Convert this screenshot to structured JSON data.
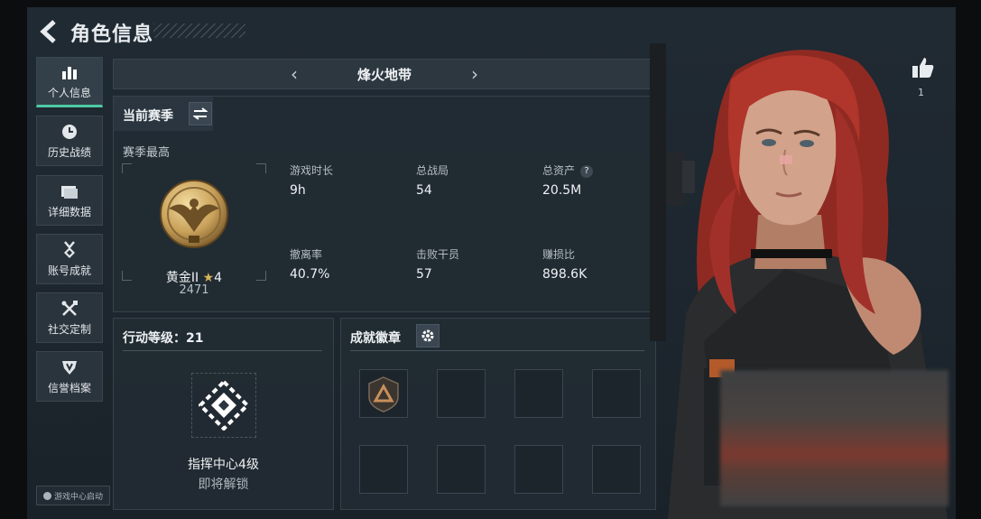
{
  "header": {
    "title": "角色信息"
  },
  "sidebar": {
    "items": [
      {
        "label": "个人信息",
        "icon": "bar-chart-icon",
        "active": true
      },
      {
        "label": "历史战绩",
        "icon": "clock-icon",
        "active": false
      },
      {
        "label": "详细数据",
        "icon": "folder-icon",
        "active": false
      },
      {
        "label": "账号成就",
        "icon": "medal-icon",
        "active": false
      },
      {
        "label": "社交定制",
        "icon": "tools-icon",
        "active": false
      },
      {
        "label": "信誉档案",
        "icon": "shield-icon",
        "active": false
      }
    ],
    "help_label": "游戏中心启动"
  },
  "map_selector": {
    "name": "烽火地带",
    "prev": "‹",
    "next": "›"
  },
  "season": {
    "title": "当前赛季",
    "subtitle": "赛季最高",
    "rank_name": "黄金II",
    "rank_stars": "4",
    "rank_score": "2471",
    "stats": [
      {
        "label": "游戏时长",
        "value": "9h"
      },
      {
        "label": "总战局",
        "value": "54"
      },
      {
        "label": "总资产",
        "value": "20.5M",
        "help": "?"
      },
      {
        "label": "撤离率",
        "value": "40.7%"
      },
      {
        "label": "击败干员",
        "value": "57"
      },
      {
        "label": "赚损比",
        "value": "898.6K"
      }
    ]
  },
  "action_level": {
    "title": "行动等级：21",
    "unlock_name": "指挥中心4级",
    "unlock_status": "即将解锁"
  },
  "achievements": {
    "title": "成就徽章"
  },
  "likes": {
    "count": "1"
  },
  "colors": {
    "accent": "#4ec9a4",
    "gold": "#c9a15a",
    "hair": "#b0352a"
  }
}
